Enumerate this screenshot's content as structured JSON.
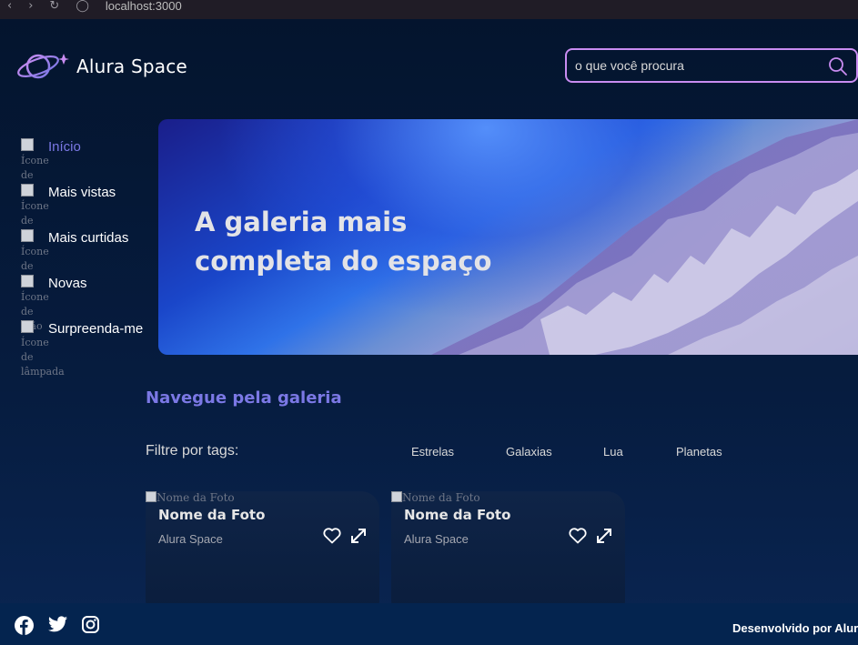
{
  "browser": {
    "url": "localhost:3000"
  },
  "header": {
    "logo_text": "Alura Space",
    "search": {
      "placeholder": "o que você procura",
      "value": ""
    }
  },
  "sidebar": {
    "items": [
      {
        "label": "Início",
        "alt": "Ícone de",
        "active": true
      },
      {
        "label": "Mais vistas",
        "alt": "Ícone de",
        "active": false
      },
      {
        "label": "Mais curtidas",
        "alt": "Ícone de",
        "active": false
      },
      {
        "label": "Novas",
        "alt": "Ícone de mão",
        "active": false
      },
      {
        "label": "Surpreenda-me",
        "alt": "Ícone de lâmpada",
        "active": false
      }
    ]
  },
  "banner": {
    "title": "A galeria mais completa do espaço"
  },
  "gallery": {
    "title": "Navegue pela galeria",
    "filter_label": "Filtre por tags:",
    "tags": [
      "Estrelas",
      "Galaxias",
      "Lua",
      "Planetas"
    ],
    "cards": [
      {
        "alt": "Nome da Foto",
        "name": "Nome da Foto",
        "author": "Alura Space"
      },
      {
        "alt": "Nome da Foto",
        "name": "Nome da Foto",
        "author": "Alura Space"
      }
    ]
  },
  "footer": {
    "credit": "Desenvolvido por Alura"
  },
  "colors": {
    "accent": "#7b78e5",
    "search_border": "#c98cf1",
    "background": "#04142d",
    "footer": "#04244f"
  }
}
